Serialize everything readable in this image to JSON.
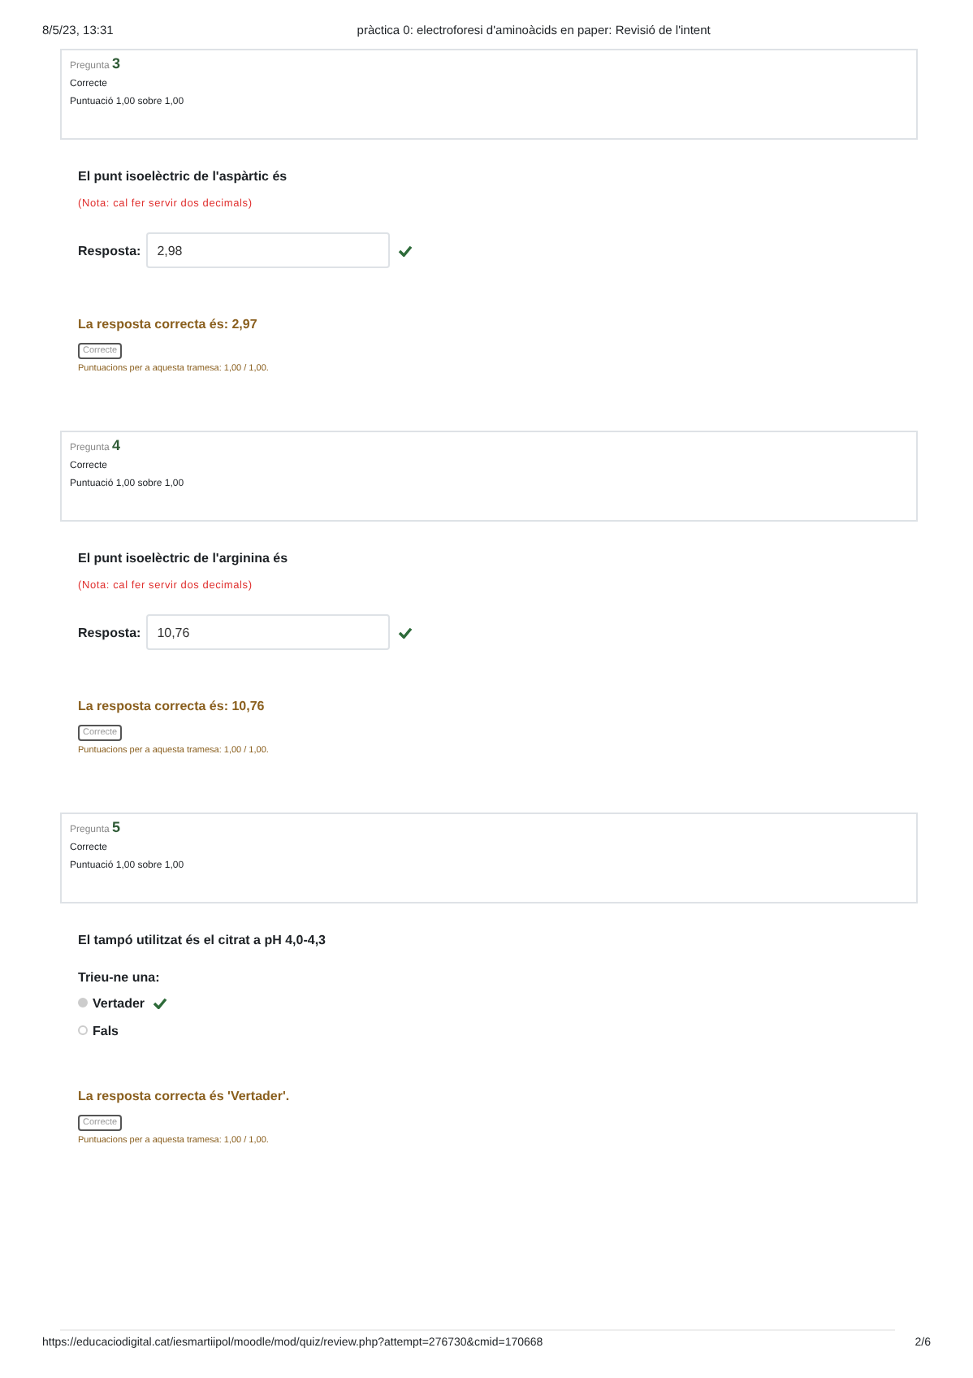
{
  "header": {
    "date": "8/5/23, 13:31",
    "title": "pràctica 0: electroforesi d'aminoàcids en paper: Revisió de l'intent"
  },
  "questions": [
    {
      "kind": "numeric",
      "label": "Pregunta",
      "number": "3",
      "state": "Correcte",
      "grade": "Puntuació 1,00 sobre 1,00",
      "text": "El punt isoelèctric de l'aspàrtic és",
      "note": "(Nota: cal fer servir dos decimals)",
      "answer_label": "Resposta:",
      "answer_value": "2,98",
      "correct": true,
      "right_answer": "La resposta correcta és: 2,97",
      "badge": "Correcte",
      "score": "Puntuacions per a aquesta tramesa: 1,00 / 1,00."
    },
    {
      "kind": "numeric",
      "label": "Pregunta",
      "number": "4",
      "state": "Correcte",
      "grade": "Puntuació 1,00 sobre 1,00",
      "text": "El punt isoelèctric de l'arginina és",
      "note": "(Nota: cal fer servir dos decimals)",
      "answer_label": "Resposta:",
      "answer_value": "10,76",
      "correct": true,
      "right_answer": "La resposta correcta és: 10,76",
      "badge": "Correcte",
      "score": "Puntuacions per a aquesta tramesa: 1,00 / 1,00."
    },
    {
      "kind": "choice",
      "label": "Pregunta",
      "number": "5",
      "state": "Correcte",
      "grade": "Puntuació 1,00 sobre 1,00",
      "text": "El tampó utilitzat és el citrat a pH 4,0-4,3",
      "prompt": "Trieu-ne una:",
      "options": [
        {
          "label": "Vertader",
          "selected": true,
          "correct": true
        },
        {
          "label": "Fals",
          "selected": false,
          "correct": false
        }
      ],
      "right_answer": "La resposta correcta és 'Vertader'.",
      "badge": "Correcte",
      "score": "Puntuacions per a aquesta tramesa: 1,00 / 1,00."
    }
  ],
  "footer": {
    "url": "https://educaciodigital.cat/iesmartiipol/moodle/mod/quiz/review.php?attempt=276730&cmid=170668",
    "page": "2/6"
  }
}
